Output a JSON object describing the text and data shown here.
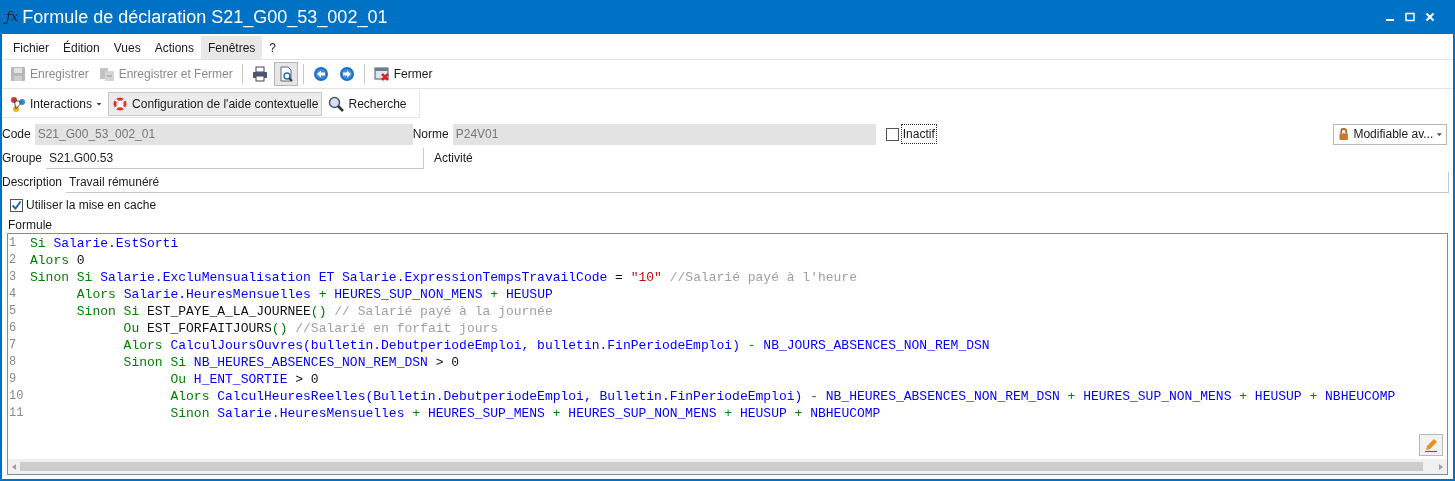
{
  "window": {
    "title": "Formule de déclaration S21_G00_53_002_01",
    "icon": "ƒx"
  },
  "menu": [
    {
      "label": "Fichier",
      "selected": false
    },
    {
      "label": "Édition",
      "selected": false
    },
    {
      "label": "Vues",
      "selected": false
    },
    {
      "label": "Actions",
      "selected": false
    },
    {
      "label": "Fenêtres",
      "selected": true
    },
    {
      "label": "?",
      "selected": false
    }
  ],
  "toolbar": [
    {
      "kind": "save",
      "label": "Enregistrer",
      "disabled": true,
      "pressed": false
    },
    {
      "kind": "save-close",
      "label": "Enregistrer et Fermer",
      "disabled": true,
      "pressed": false
    },
    {
      "kind": "separator"
    },
    {
      "kind": "print",
      "disabled": false,
      "pressed": false
    },
    {
      "kind": "preview",
      "disabled": false,
      "pressed": true
    },
    {
      "kind": "separator"
    },
    {
      "kind": "back",
      "disabled": false,
      "pressed": false
    },
    {
      "kind": "forward",
      "disabled": false,
      "pressed": false
    },
    {
      "kind": "separator"
    },
    {
      "kind": "close",
      "label": "Fermer",
      "disabled": false,
      "pressed": false
    }
  ],
  "toolbar2": [
    {
      "kind": "interactions",
      "label": "Interactions",
      "dropdown": true,
      "selected": false
    },
    {
      "kind": "help",
      "label": "Configuration de l'aide contextuelle",
      "dropdown": false,
      "selected": true
    },
    {
      "kind": "search",
      "label": "Recherche",
      "dropdown": false,
      "selected": false
    }
  ],
  "form": {
    "code": {
      "label": "Code",
      "value": "S21_G00_53_002_01",
      "disabled": true
    },
    "norme": {
      "label": "Norme",
      "value": "P24V01",
      "disabled": true
    },
    "inactif": {
      "label": "Inactif",
      "checked": false
    },
    "access": {
      "value": "Modifiable av..."
    },
    "groupe": {
      "label": "Groupe",
      "value": "S21.G00.53",
      "disabled": false
    },
    "activite": {
      "label": "Activité"
    },
    "description": {
      "label": "Description",
      "value": "Travail rémunéré",
      "disabled": false
    },
    "cache": {
      "label": "Utiliser la mise en cache",
      "checked": true
    },
    "formule_label": "Formule"
  },
  "editor": {
    "lines": [
      {
        "number": "1",
        "tokens": [
          {
            "kind": "kw",
            "text": "Si "
          },
          {
            "kind": "id",
            "text": "Salarie.EstSorti"
          }
        ]
      },
      {
        "number": "2",
        "tokens": [
          {
            "kind": "kw",
            "text": "Alors "
          },
          {
            "kind": "num",
            "text": "0"
          }
        ]
      },
      {
        "number": "3",
        "tokens": [
          {
            "kind": "kw",
            "text": "Sinon Si "
          },
          {
            "kind": "id",
            "text": "Salarie.ExcluMensualisation ET Salarie.ExpressionTempsTravailCode "
          },
          {
            "kind": "num",
            "text": "= "
          },
          {
            "kind": "str",
            "text": "\"10\""
          },
          {
            "kind": "cmt",
            "text": " //Salarié payé à l'heure"
          }
        ]
      },
      {
        "number": "4",
        "tokens": [
          {
            "kind": "kw",
            "text": "      Alors "
          },
          {
            "kind": "id",
            "text": "Salarie.HeuresMensuelles "
          },
          {
            "kind": "op",
            "text": "+ "
          },
          {
            "kind": "id",
            "text": "HEURES_SUP_NON_MENS "
          },
          {
            "kind": "op",
            "text": "+ "
          },
          {
            "kind": "id",
            "text": "HEUSUP"
          }
        ]
      },
      {
        "number": "5",
        "tokens": [
          {
            "kind": "kw",
            "text": "      Sinon Si "
          },
          {
            "kind": "fn",
            "text": "EST_PAYE_A_LA_JOURNEE"
          },
          {
            "kind": "op",
            "text": "()"
          },
          {
            "kind": "cmt",
            "text": " // Salarié payé à la journée"
          }
        ]
      },
      {
        "number": "6",
        "tokens": [
          {
            "kind": "kw",
            "text": "            Ou "
          },
          {
            "kind": "fn",
            "text": "EST_FORFAITJOURS"
          },
          {
            "kind": "op",
            "text": "()"
          },
          {
            "kind": "cmt",
            "text": " //Salarié en forfait jours"
          }
        ]
      },
      {
        "number": "7",
        "tokens": [
          {
            "kind": "kw",
            "text": "            Alors "
          },
          {
            "kind": "id",
            "text": "CalculJoursOuvres(bulletin.DebutperiodeEmploi, bulletin.FinPeriodeEmploi) "
          },
          {
            "kind": "op",
            "text": "- "
          },
          {
            "kind": "id",
            "text": "NB_JOURS_ABSENCES_NON_REM_DSN"
          }
        ]
      },
      {
        "number": "8",
        "tokens": [
          {
            "kind": "kw",
            "text": "            Sinon Si "
          },
          {
            "kind": "id",
            "text": "NB_HEURES_ABSENCES_NON_REM_DSN "
          },
          {
            "kind": "num",
            "text": "> 0"
          }
        ]
      },
      {
        "number": "9",
        "tokens": [
          {
            "kind": "kw",
            "text": "                  Ou "
          },
          {
            "kind": "id",
            "text": "H_ENT_SORTIE "
          },
          {
            "kind": "num",
            "text": "> 0"
          }
        ]
      },
      {
        "number": "10",
        "tokens": [
          {
            "kind": "kw",
            "text": "                  Alors "
          },
          {
            "kind": "id",
            "text": "CalculHeuresReelles(Bulletin.DebutperiodeEmploi, Bulletin.FinPeriodeEmploi) "
          },
          {
            "kind": "op",
            "text": "- "
          },
          {
            "kind": "id",
            "text": "NB_HEURES_ABSENCES_NON_REM_DSN "
          },
          {
            "kind": "op",
            "text": "+ "
          },
          {
            "kind": "id",
            "text": "HEURES_SUP_NON_MENS "
          },
          {
            "kind": "op",
            "text": "+ "
          },
          {
            "kind": "id",
            "text": "HEUSUP "
          },
          {
            "kind": "op",
            "text": "+ "
          },
          {
            "kind": "id",
            "text": "NBHEUCOMP"
          }
        ]
      },
      {
        "number": "11",
        "tokens": [
          {
            "kind": "kw",
            "text": "                  Sinon "
          },
          {
            "kind": "id",
            "text": "Salarie.HeuresMensuelles "
          },
          {
            "kind": "op",
            "text": "+ "
          },
          {
            "kind": "id",
            "text": "HEURES_SUP_MENS "
          },
          {
            "kind": "op",
            "text": "+ "
          },
          {
            "kind": "id",
            "text": "HEURES_SUP_NON_MENS "
          },
          {
            "kind": "op",
            "text": "+ "
          },
          {
            "kind": "id",
            "text": "HEUSUP "
          },
          {
            "kind": "op",
            "text": "+ "
          },
          {
            "kind": "id",
            "text": "NBHEUCOMP"
          }
        ]
      }
    ]
  }
}
